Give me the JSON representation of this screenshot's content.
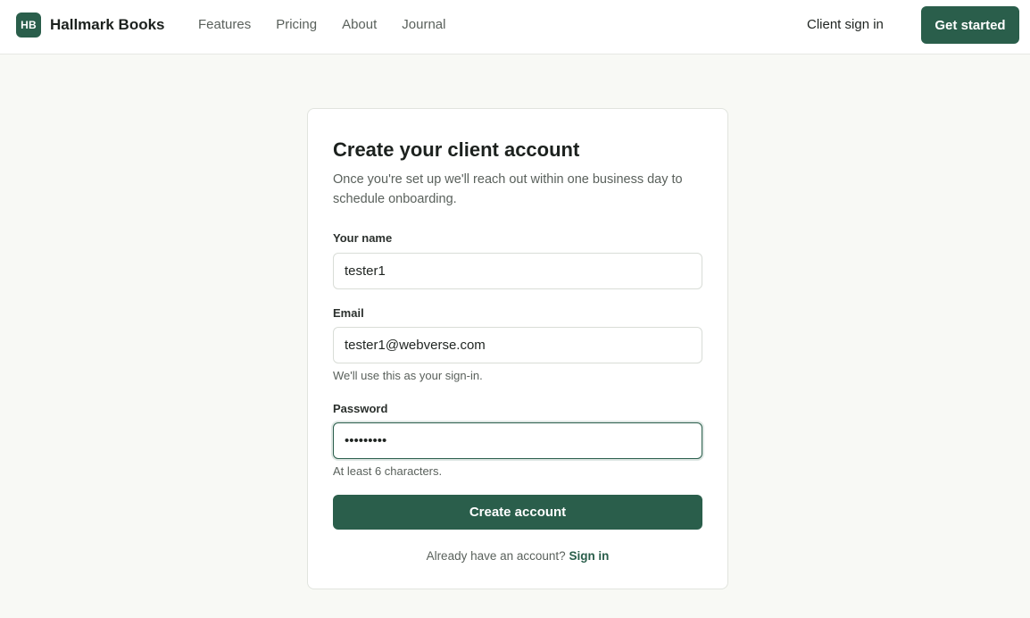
{
  "nav": {
    "logo_mark": "HB",
    "brand_name": "Hallmark Books",
    "links": [
      "Features",
      "Pricing",
      "About",
      "Journal"
    ],
    "sign_in": "Client sign in",
    "cta": "Get started"
  },
  "form": {
    "title": "Create your client account",
    "subtitle": "Once you're set up we'll reach out within one business day to schedule onboarding.",
    "name_label": "Your name",
    "name_value": "tester1",
    "email_label": "Email",
    "email_value": "tester1@webverse.com",
    "email_hint": "We'll use this as your sign-in.",
    "password_label": "Password",
    "password_value": "tester123",
    "password_hint": "At least 6 characters.",
    "submit_label": "Create account",
    "footer_text": "Already have an account?",
    "footer_link": "Sign in"
  },
  "colors": {
    "accent": "#2a5e4b",
    "background": "#f8f9f5"
  }
}
